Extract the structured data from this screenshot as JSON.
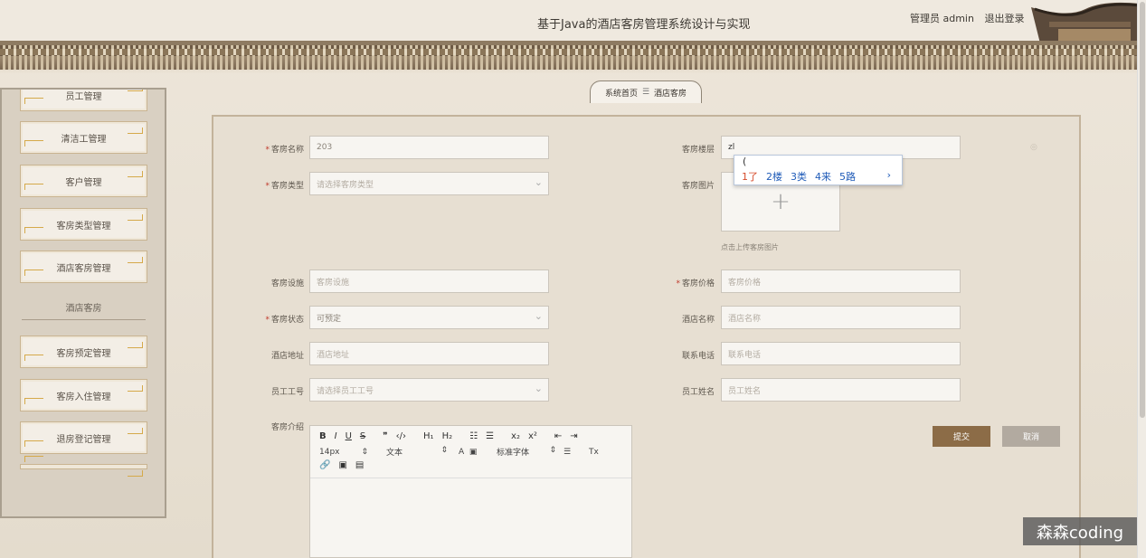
{
  "header": {
    "title": "基于Java的酒店客房管理系统设计与实现",
    "user_label": "管理员 admin",
    "logout_label": "退出登录"
  },
  "sidebar": {
    "items_top": [
      "员工管理",
      "清洁工管理",
      "客户管理",
      "客房类型管理",
      "酒店客房管理"
    ],
    "group_title": "酒店客房",
    "items_bottom": [
      "客房预定管理",
      "客房入住管理",
      "退房登记管理"
    ]
  },
  "breadcrumb": {
    "home": "系统首页",
    "sep": "☰",
    "current": "酒店客房"
  },
  "form": {
    "room_name": {
      "label": "客房名称",
      "value": "203"
    },
    "room_type": {
      "label": "客房类型",
      "placeholder": "请选择客房类型"
    },
    "room_floor": {
      "label": "客房楼层",
      "value": "zl"
    },
    "room_image": {
      "label": "客房图片",
      "hint": "点击上传客房图片",
      "plus": "+"
    },
    "facilities": {
      "label": "客房设施",
      "placeholder": "客房设施"
    },
    "price": {
      "label": "客房价格",
      "placeholder": "客房价格"
    },
    "status": {
      "label": "客房状态",
      "value": "可预定"
    },
    "hotel_name": {
      "label": "酒店名称",
      "placeholder": "酒店名称"
    },
    "hotel_address": {
      "label": "酒店地址",
      "placeholder": "酒店地址"
    },
    "phone": {
      "label": "联系电话",
      "placeholder": "联系电话"
    },
    "staff_id": {
      "label": "员工工号",
      "placeholder": "请选择员工工号"
    },
    "staff_name": {
      "label": "员工姓名",
      "placeholder": "员工姓名"
    },
    "intro": {
      "label": "客房介绍"
    }
  },
  "editor": {
    "row1": [
      "B",
      "I",
      "U",
      "S",
      "❞",
      "‹/›",
      "H₁",
      "H₂",
      "☷",
      "☰",
      "x₂",
      "x²",
      "⇤",
      "⇥"
    ],
    "size": "14px",
    "font": "文本",
    "family": "标准字体",
    "row3": [
      "🔗",
      "▣",
      "▤"
    ]
  },
  "ime": {
    "composition": "(",
    "candidates": [
      "1了",
      "2楼",
      "3类",
      "4来",
      "5路"
    ],
    "more": "›"
  },
  "buttons": {
    "submit": "提交",
    "cancel": "取消"
  },
  "watermark": "森森coding",
  "colors": {
    "accent": "#8c6c47",
    "required": "#c0392b",
    "ime_candidate": "#1f5bb8"
  }
}
